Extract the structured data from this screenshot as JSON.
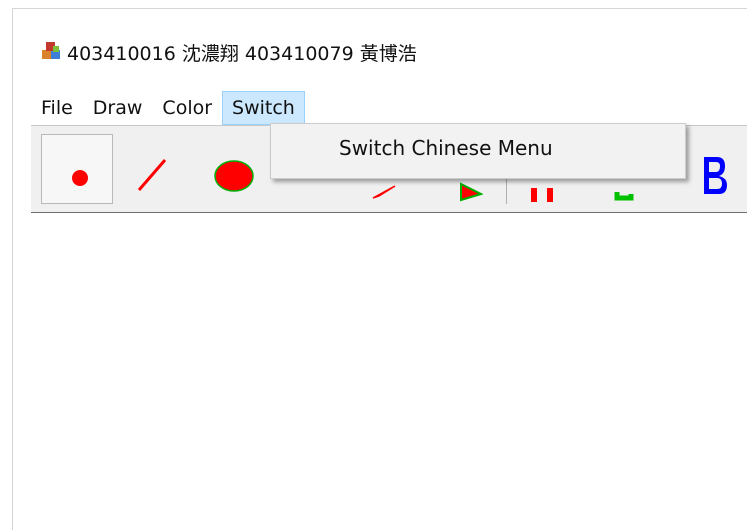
{
  "window": {
    "title": "403410016 沈濃翔 403410079 黃博浩",
    "icon": "app-blocks-icon"
  },
  "menu": {
    "items": [
      "File",
      "Draw",
      "Color",
      "Switch"
    ],
    "active": "Switch"
  },
  "dropdown": {
    "items": [
      "Switch Chinese Menu"
    ]
  },
  "toolbar": {
    "tools": [
      {
        "icon": "dot-icon",
        "color": "#ff0000"
      },
      {
        "icon": "line-icon",
        "color": "#ff0000"
      },
      {
        "icon": "ellipse-icon",
        "color": "#ff0000"
      },
      {
        "icon": "curve-icon",
        "color": "#ff0000"
      },
      {
        "icon": "triangle-icon",
        "color": "#ff0000"
      },
      {
        "icon": "red-r-icon",
        "color": "#ff0000"
      },
      {
        "icon": "green-g-icon",
        "color": "#00c000"
      },
      {
        "icon": "blue-b-icon",
        "color": "#0000ff"
      }
    ]
  },
  "colors": {
    "menu_highlight": "#cce8ff",
    "red": "#ff0000",
    "green": "#00c000",
    "blue": "#0000ff"
  }
}
